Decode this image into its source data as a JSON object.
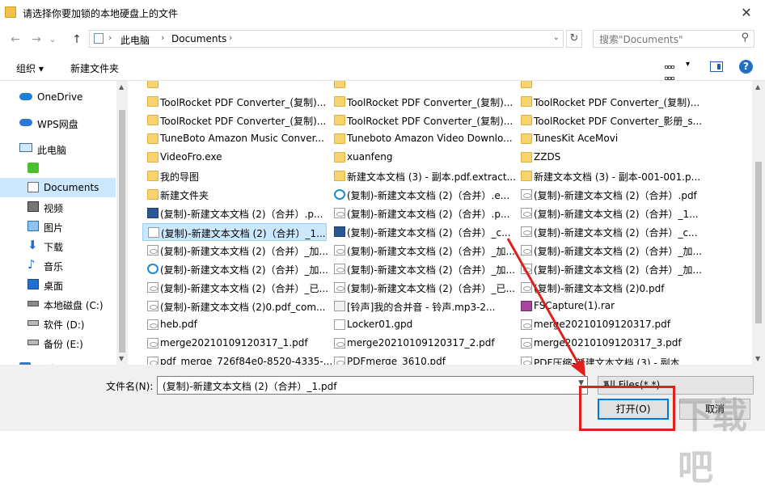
{
  "window": {
    "title": "请选择你要加锁的本地硬盘上的文件",
    "close_glyph": "✕"
  },
  "nav": {
    "back_glyph": "←",
    "forward_glyph": "→",
    "recent_glyph": "⌄",
    "up_glyph": "↑",
    "breadcrumbs": [
      "此电脑",
      "Documents"
    ],
    "refresh_glyph": "↻",
    "search_placeholder": "搜索\"Documents\"",
    "search_icon": "search-icon"
  },
  "toolbar": {
    "organize_label": "组织 ▾",
    "new_folder_label": "新建文件夹",
    "help_label": "?"
  },
  "sidebar": {
    "items": [
      {
        "label": "OneDrive",
        "icon": "cloud-icon"
      },
      {
        "label": "WPS网盘",
        "icon": "wps-cloud-icon"
      },
      {
        "label": "此电脑",
        "icon": "computer-icon"
      },
      {
        "label": "",
        "icon": "iqiyi-icon"
      },
      {
        "label": "Documents",
        "icon": "documents-icon",
        "selected": true
      },
      {
        "label": "视频",
        "icon": "video-icon"
      },
      {
        "label": "图片",
        "icon": "pictures-icon"
      },
      {
        "label": "下载",
        "icon": "download-icon"
      },
      {
        "label": "音乐",
        "icon": "music-icon"
      },
      {
        "label": "桌面",
        "icon": "desktop-icon"
      },
      {
        "label": "本地磁盘 (C:)",
        "icon": "drive-icon"
      },
      {
        "label": "软件 (D:)",
        "icon": "drive-icon"
      },
      {
        "label": "备份 (E:)",
        "icon": "drive-icon"
      },
      {
        "label": "网络",
        "icon": "network-icon"
      }
    ]
  },
  "files": {
    "col1": [
      {
        "name": "",
        "type": "folder"
      },
      {
        "name": "ToolRocket PDF Converter_(复制)...",
        "type": "folder"
      },
      {
        "name": "ToolRocket PDF Converter_(复制)...",
        "type": "folder"
      },
      {
        "name": "TuneBoto Amazon Music Conver...",
        "type": "folder"
      },
      {
        "name": "VideoFro.exe",
        "type": "folder"
      },
      {
        "name": "我的导图",
        "type": "folder"
      },
      {
        "name": "新建文件夹",
        "type": "folder"
      },
      {
        "name": "(复制)-新建文本文档 (2)（合并）.p...",
        "type": "word"
      },
      {
        "name": "(复制)-新建文本文档 (2)（合并）_1...",
        "type": "doc",
        "selected": true
      },
      {
        "name": "(复制)-新建文本文档 (2)（合并）_加...",
        "type": "pdf"
      },
      {
        "name": "(复制)-新建文本文档 (2)（合并）_加...",
        "type": "edge"
      },
      {
        "name": "(复制)-新建文本文档 (2)（合并）_已...",
        "type": "pdf"
      },
      {
        "name": "(复制)-新建文本文档 (2)0.pdf_com...",
        "type": "pdf"
      },
      {
        "name": "heb.pdf",
        "type": "pdf"
      },
      {
        "name": "merge20210109120317_1.pdf",
        "type": "pdf"
      },
      {
        "name": "pdf_merge_726f84e0-8520-4335-...",
        "type": "pdf"
      }
    ],
    "col2": [
      {
        "name": "",
        "type": "folder"
      },
      {
        "name": "ToolRocket PDF Converter_(复制)...",
        "type": "folder"
      },
      {
        "name": "ToolRocket PDF Converter_(复制)...",
        "type": "folder"
      },
      {
        "name": "Tuneboto Amazon Video Downlo...",
        "type": "folder"
      },
      {
        "name": "xuanfeng",
        "type": "folder"
      },
      {
        "name": "新建文本文档 (3) - 副本.pdf.extract...",
        "type": "folder"
      },
      {
        "name": "(复制)-新建文本文档 (2)（合并）.e...",
        "type": "edge"
      },
      {
        "name": "(复制)-新建文本文档 (2)（合并）.p...",
        "type": "pdf"
      },
      {
        "name": "(复制)-新建文本文档 (2)（合并）_c...",
        "type": "word"
      },
      {
        "name": "(复制)-新建文本文档 (2)（合并）_加...",
        "type": "pdf"
      },
      {
        "name": "(复制)-新建文本文档 (2)（合并）_加...",
        "type": "pdf"
      },
      {
        "name": "(复制)-新建文本文档 (2)（合并）_已...",
        "type": "pdf"
      },
      {
        "name": "[铃声]我的合并音 - 铃声.mp3-2...",
        "type": "mp3"
      },
      {
        "name": "Locker01.gpd",
        "type": "doc"
      },
      {
        "name": "merge20210109120317_2.pdf",
        "type": "pdf"
      },
      {
        "name": "PDFmerge_3610.pdf",
        "type": "pdf"
      }
    ],
    "col3": [
      {
        "name": "",
        "type": "folder"
      },
      {
        "name": "ToolRocket PDF Converter_(复制)...",
        "type": "folder"
      },
      {
        "name": "ToolRocket PDF Converter_影册_s...",
        "type": "folder"
      },
      {
        "name": "TunesKit AceMovi",
        "type": "folder"
      },
      {
        "name": "ZZDS",
        "type": "folder"
      },
      {
        "name": "新建文本文档 (3) - 副本-001-001.p...",
        "type": "folder"
      },
      {
        "name": "(复制)-新建文本文档 (2)（合并）.pdf",
        "type": "pdf"
      },
      {
        "name": "(复制)-新建文本文档 (2)（合并）_1...",
        "type": "pdf"
      },
      {
        "name": "(复制)-新建文本文档 (2)（合并）_c...",
        "type": "pdf"
      },
      {
        "name": "(复制)-新建文本文档 (2)（合并）_加...",
        "type": "pdf"
      },
      {
        "name": "(复制)-新建文本文档 (2)（合并）_加...",
        "type": "pdf"
      },
      {
        "name": "(复制)-新建文本文档 (2)0.pdf",
        "type": "pdf"
      },
      {
        "name": "FSCapture(1).rar",
        "type": "rar"
      },
      {
        "name": "merge20210109120317.pdf",
        "type": "pdf"
      },
      {
        "name": "merge20210109120317_3.pdf",
        "type": "pdf"
      },
      {
        "name": "PDF压缩-新建文本文档 (3) - 副本_...",
        "type": "pdf"
      }
    ]
  },
  "bottom": {
    "filename_label": "文件名(N):",
    "filename_value": "(复制)-新建文本文档 (2)（合并）_1.pdf",
    "filetype_value": "All Files(*.*)",
    "open_label": "打开(O)",
    "cancel_label": "取消"
  },
  "annotation": {
    "highlight_color": "#e0201f"
  },
  "watermark": "下载吧"
}
